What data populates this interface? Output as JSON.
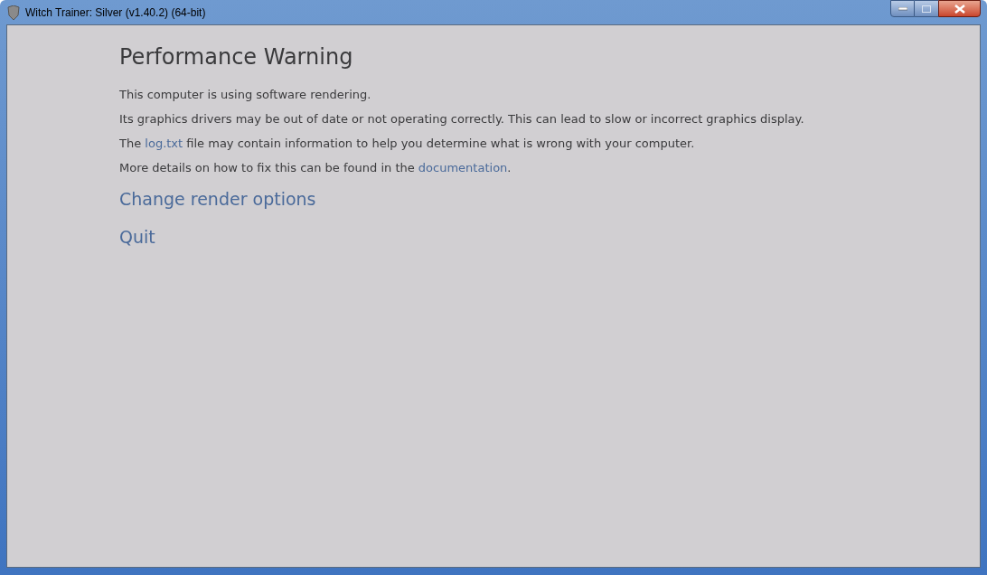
{
  "window": {
    "title": "Witch Trainer: Silver (v1.40.2) (64-bit)"
  },
  "heading": "Performance Warning",
  "paragraphs": [
    [
      {
        "kind": "text",
        "text": "This computer is using software rendering."
      }
    ],
    [
      {
        "kind": "text",
        "text": "Its graphics drivers may be out of date or not operating correctly. This can lead to slow or incorrect graphics display."
      }
    ],
    [
      {
        "kind": "text",
        "text": "The "
      },
      {
        "kind": "link",
        "text": "log.txt"
      },
      {
        "kind": "text",
        "text": " file may contain information to help you determine what is wrong with your computer."
      }
    ],
    [
      {
        "kind": "text",
        "text": "More details on how to fix this can be found in the "
      },
      {
        "kind": "link",
        "text": "documentation"
      },
      {
        "kind": "text",
        "text": "."
      }
    ]
  ],
  "actions": [
    "Change render options",
    "Quit"
  ]
}
